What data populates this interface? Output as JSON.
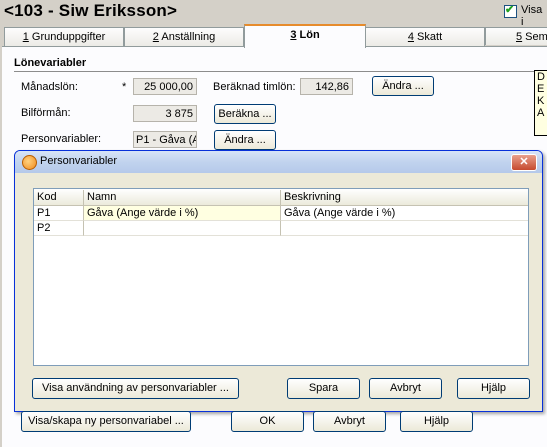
{
  "header": {
    "title": "<103 - Siw Eriksson>",
    "checkbox_label": "Visa i",
    "checkbox_checked": true
  },
  "tabs": [
    {
      "key": "1",
      "label": " Grunduppgifter",
      "active": false
    },
    {
      "key": "2",
      "label": " Anställning",
      "active": false
    },
    {
      "key": "3",
      "label": " Lön",
      "active": true
    },
    {
      "key": "4",
      "label": " Skatt",
      "active": false
    },
    {
      "key": "5",
      "label": " Sem",
      "active": false
    }
  ],
  "lonevariabler": {
    "section_title": "Lönevariabler",
    "manadslon_label": "Månadslön:",
    "manadslon_marker": "*",
    "manadslon_value": "25 000,00",
    "timlon_label": "Beräknad timlön:",
    "timlon_value": "142,86",
    "andra1_label": "Ändra ...",
    "bilformon_label": "Bilförmån:",
    "bilformon_value": "3 875",
    "berakna_label": "Beräkna ...",
    "personvariabler_label": "Personvariabler:",
    "personvariabler_value": "P1 - Gåva (A",
    "andra2_label": "Ändra ...",
    "note_lines": [
      "D",
      "E",
      "K",
      "A"
    ]
  },
  "dialog": {
    "title": "Personvariabler",
    "columns": [
      "Kod",
      "Namn",
      "Beskrivning"
    ],
    "rows": [
      {
        "kod": "P1",
        "namn": "Gåva (Ange värde i %)",
        "beskrivning": "Gåva (Ange värde i %)"
      },
      {
        "kod": "P2",
        "namn": "",
        "beskrivning": ""
      }
    ],
    "buttons": {
      "visa_anvandning": "Visa användning av personvariabler ...",
      "spara": "Spara",
      "avbryt": "Avbryt",
      "hjalp": "Hjälp"
    }
  },
  "footer": {
    "visa_skapa": "Visa/skapa ny personvariabel ...",
    "ok": "OK",
    "avbryt": "Avbryt",
    "hjalp": "Hjälp"
  }
}
